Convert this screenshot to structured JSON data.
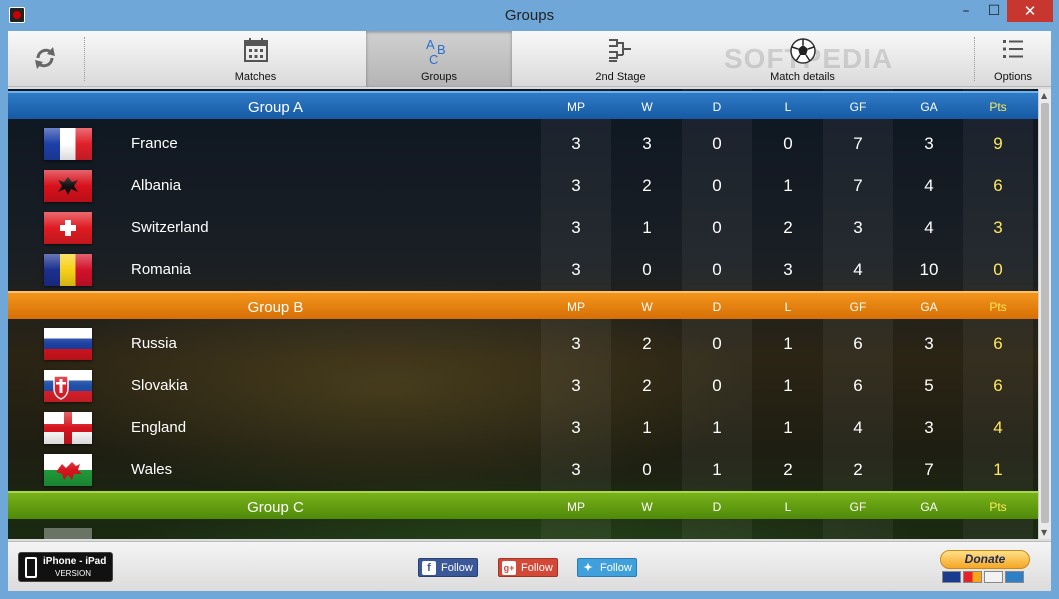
{
  "window": {
    "title": "Groups",
    "minimize": "–",
    "maximize": "☐",
    "close": "✕"
  },
  "toolbar": {
    "items": [
      {
        "label": "Matches"
      },
      {
        "label": "Groups"
      },
      {
        "label": "2nd Stage"
      },
      {
        "label": "Match details"
      },
      {
        "label": "Options"
      }
    ],
    "active": "Groups",
    "watermark": "SOFTPEDIA"
  },
  "columns": [
    "MP",
    "W",
    "D",
    "L",
    "GF",
    "GA",
    "Pts"
  ],
  "groups": [
    {
      "name": "Group A",
      "color": "#1f6cb8",
      "teams": [
        {
          "name": "France",
          "flag": "france-flag",
          "mp": "3",
          "w": "3",
          "d": "0",
          "l": "0",
          "gf": "7",
          "ga": "3",
          "pts": "9"
        },
        {
          "name": "Albania",
          "flag": "albania-flag",
          "mp": "3",
          "w": "2",
          "d": "0",
          "l": "1",
          "gf": "7",
          "ga": "4",
          "pts": "6"
        },
        {
          "name": "Switzerland",
          "flag": "switzerland-flag",
          "mp": "3",
          "w": "1",
          "d": "0",
          "l": "2",
          "gf": "3",
          "ga": "4",
          "pts": "3"
        },
        {
          "name": "Romania",
          "flag": "romania-flag",
          "mp": "3",
          "w": "0",
          "d": "0",
          "l": "3",
          "gf": "4",
          "ga": "10",
          "pts": "0"
        }
      ]
    },
    {
      "name": "Group B",
      "color": "#e8800f",
      "teams": [
        {
          "name": "Russia",
          "flag": "russia-flag",
          "mp": "3",
          "w": "2",
          "d": "0",
          "l": "1",
          "gf": "6",
          "ga": "3",
          "pts": "6"
        },
        {
          "name": "Slovakia",
          "flag": "slovakia-flag",
          "mp": "3",
          "w": "2",
          "d": "0",
          "l": "1",
          "gf": "6",
          "ga": "5",
          "pts": "6"
        },
        {
          "name": "England",
          "flag": "england-flag",
          "mp": "3",
          "w": "1",
          "d": "1",
          "l": "1",
          "gf": "4",
          "ga": "3",
          "pts": "4"
        },
        {
          "name": "Wales",
          "flag": "wales-flag",
          "mp": "3",
          "w": "0",
          "d": "1",
          "l": "2",
          "gf": "2",
          "ga": "7",
          "pts": "1"
        }
      ]
    },
    {
      "name": "Group C",
      "color": "#66a013",
      "teams": []
    }
  ],
  "footer": {
    "iphone_line1": "iPhone - iPad",
    "iphone_line2": "VERSION",
    "facebook_follow": "Follow",
    "googleplus_follow": "Follow",
    "twitter_follow": "Follow",
    "donate": "Donate"
  }
}
